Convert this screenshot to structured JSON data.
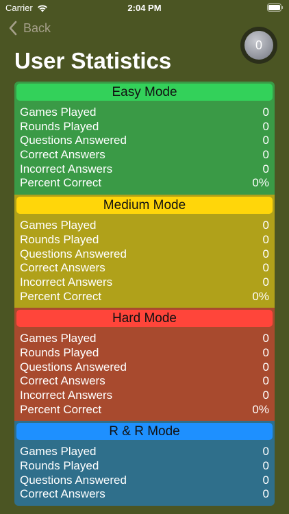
{
  "status_bar": {
    "carrier": "Carrier",
    "time": "2:04 PM"
  },
  "nav": {
    "back_label": "Back",
    "coin_count": "0"
  },
  "page": {
    "title": "User Statistics"
  },
  "colors": {
    "background": "#4b5523",
    "easy_header": "#33d15a",
    "easy_body": "#3a9a46",
    "medium_header": "#ffd60a",
    "medium_body": "#b0a11a",
    "hard_header": "#ff453a",
    "hard_body": "#a84a2e",
    "rr_header": "#1e90ff",
    "rr_body": "#2f6f8b"
  },
  "modes": [
    {
      "title": "Easy Mode",
      "rows": [
        {
          "label": "Games Played",
          "value": "0"
        },
        {
          "label": "Rounds Played",
          "value": "0"
        },
        {
          "label": "Questions Answered",
          "value": "0"
        },
        {
          "label": "Correct Answers",
          "value": "0"
        },
        {
          "label": "Incorrect Answers",
          "value": "0"
        },
        {
          "label": "Percent Correct",
          "value": "0%"
        }
      ]
    },
    {
      "title": "Medium Mode",
      "rows": [
        {
          "label": "Games Played",
          "value": "0"
        },
        {
          "label": "Rounds Played",
          "value": "0"
        },
        {
          "label": "Questions Answered",
          "value": "0"
        },
        {
          "label": "Correct Answers",
          "value": "0"
        },
        {
          "label": "Incorrect Answers",
          "value": "0"
        },
        {
          "label": "Percent Correct",
          "value": "0%"
        }
      ]
    },
    {
      "title": "Hard Mode",
      "rows": [
        {
          "label": "Games Played",
          "value": "0"
        },
        {
          "label": "Rounds Played",
          "value": "0"
        },
        {
          "label": "Questions Answered",
          "value": "0"
        },
        {
          "label": "Correct Answers",
          "value": "0"
        },
        {
          "label": "Incorrect Answers",
          "value": "0"
        },
        {
          "label": "Percent Correct",
          "value": "0%"
        }
      ]
    },
    {
      "title": "R & R Mode",
      "rows": [
        {
          "label": "Games Played",
          "value": "0"
        },
        {
          "label": "Rounds Played",
          "value": "0"
        },
        {
          "label": "Questions Answered",
          "value": "0"
        },
        {
          "label": "Correct Answers",
          "value": "0"
        }
      ]
    }
  ]
}
